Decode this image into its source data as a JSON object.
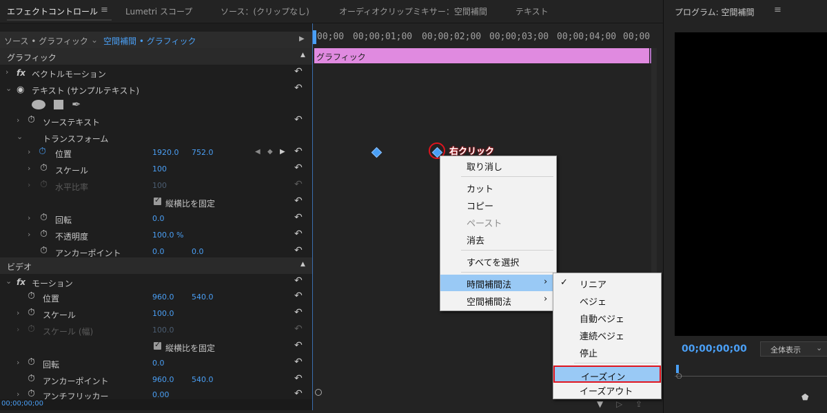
{
  "tabs": [
    {
      "label": "エフェクトコントロール",
      "active": true
    },
    {
      "label": "Lumetri スコープ"
    },
    {
      "label": "ソース：(クリップなし)"
    },
    {
      "label": "オーディオクリップミキサー：空間補間"
    },
    {
      "label": "テキスト"
    }
  ],
  "program_tab": "プログラム: 空間補間",
  "menu_icon": "≡",
  "source_bar": {
    "source": "ソース • グラフィック",
    "sequence": "空間補間 • グラフィック"
  },
  "sections": {
    "graphics": "グラフィック",
    "video": "ビデオ"
  },
  "rows": {
    "vector_motion": "ベクトルモーション",
    "text_layer": "テキスト (サンプルテキスト)",
    "source_text": "ソーステキスト",
    "transform": "トランスフォーム",
    "position": {
      "label": "位置",
      "x": "1920.0",
      "y": "752.0"
    },
    "scale": {
      "label": "スケール",
      "value": "100"
    },
    "h_ratio": {
      "label": "水平比率",
      "value": "100"
    },
    "lock_aspect": "縦横比を固定",
    "rotation": {
      "label": "回転",
      "value": "0.0"
    },
    "opacity": {
      "label": "不透明度",
      "value": "100.0 %"
    },
    "anchor": {
      "label": "アンカーポイント",
      "x": "0.0",
      "y": "0.0"
    },
    "motion": "モーション",
    "v_position": {
      "label": "位置",
      "x": "960.0",
      "y": "540.0"
    },
    "v_scale": {
      "label": "スケール",
      "value": "100.0"
    },
    "v_scale_w": {
      "label": "スケール (幅)",
      "value": "100.0"
    },
    "v_lock_aspect": "縦横比を固定",
    "v_rotation": {
      "label": "回転",
      "value": "0.0"
    },
    "v_anchor": {
      "label": "アンカーポイント",
      "x": "960.0",
      "y": "540.0"
    },
    "anti_flicker": {
      "label": "アンチフリッカー",
      "value": "0.00"
    }
  },
  "current_time_left": "00;00;00;00",
  "ruler": [
    "00;00",
    "00;00;01;00",
    "00;00;02;00",
    "00;00;03;00",
    "00;00;04;00",
    "00;00"
  ],
  "clip_label": "グラフィック",
  "annotation": "右クリック",
  "context_menu": {
    "items": [
      "取り消し",
      "カット",
      "コピー",
      "ペースト",
      "消去",
      "すべてを選択",
      "時間補間法",
      "空間補間法"
    ],
    "disabled": [
      "ペースト"
    ]
  },
  "submenu": {
    "items": [
      "リニア",
      "ベジェ",
      "自動ベジェ",
      "連続ベジェ",
      "停止",
      "イーズイン",
      "イーズアウト"
    ],
    "checked": "リニア",
    "highlighted": "イーズイン"
  },
  "program": {
    "timecode": "00;00;00;00",
    "zoom": "全体表示"
  },
  "colors": {
    "accent": "#4a9ff5",
    "clip": "#e08ae0",
    "highlight_red": "#e0141e"
  }
}
